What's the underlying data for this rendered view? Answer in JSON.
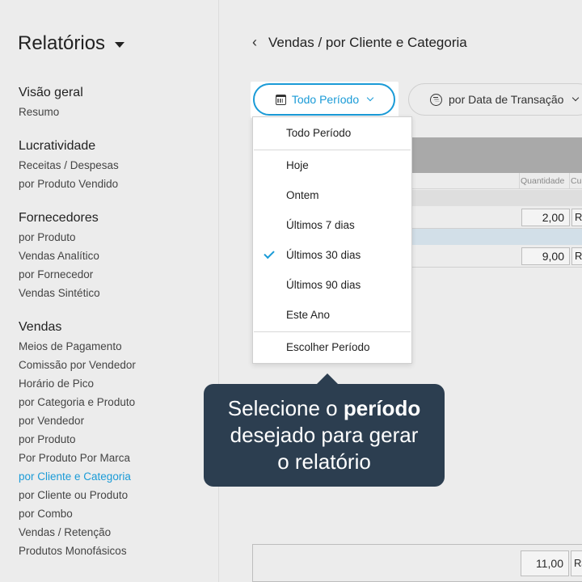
{
  "sidebar": {
    "title": "Relatórios",
    "sections": [
      {
        "heading": "Visão geral",
        "items": [
          "Resumo"
        ]
      },
      {
        "heading": "Lucratividade",
        "items": [
          "Receitas / Despesas",
          "por Produto Vendido"
        ]
      },
      {
        "heading": "Fornecedores",
        "items": [
          "por Produto",
          "Vendas Analítico",
          "por Fornecedor",
          "Vendas Sintético"
        ]
      },
      {
        "heading": "Vendas",
        "items": [
          "Meios de Pagamento",
          "Comissão por Vendedor",
          "Horário de Pico",
          "por Categoria e Produto",
          "por Vendedor",
          "por Produto",
          "Por Produto Por Marca",
          "por Cliente e Categoria",
          "por Cliente ou Produto",
          "por Combo",
          "Vendas / Retenção",
          "Produtos Monofásicos"
        ]
      }
    ],
    "active_item": "por Cliente e Categoria"
  },
  "header": {
    "back_icon": "chevron-left-icon",
    "breadcrumb": "Vendas / por Cliente e Categoria"
  },
  "toolbar": {
    "period_button": "Todo Período",
    "period_icon": "calendar-icon",
    "date_filter_button": "por Data de Transação",
    "date_filter_icon": "filter-circle-icon"
  },
  "period_menu": {
    "options": [
      "Todo Período",
      "Hoje",
      "Ontem",
      "Últimos 7 dias",
      "Últimos 30 dias",
      "Últimos 90 dias",
      "Este Ano",
      "Escolher Período"
    ],
    "checked": "Últimos 30 dias"
  },
  "table": {
    "columns": [
      "Quantidade",
      "Cu"
    ],
    "rows": [
      {
        "quantity": "2,00",
        "currency": "R$"
      },
      {
        "quantity": "9,00",
        "currency": "R$"
      }
    ],
    "total": {
      "quantity": "11,00",
      "currency": "R$"
    }
  },
  "tooltip": {
    "line1_pre": "Selecione o ",
    "line1_bold": "período",
    "line2": "desejado para gerar",
    "line3": "o relatório"
  },
  "colors": {
    "accent": "#1a9bd7",
    "tooltip_bg": "#2c3e50",
    "background": "#ececec"
  }
}
